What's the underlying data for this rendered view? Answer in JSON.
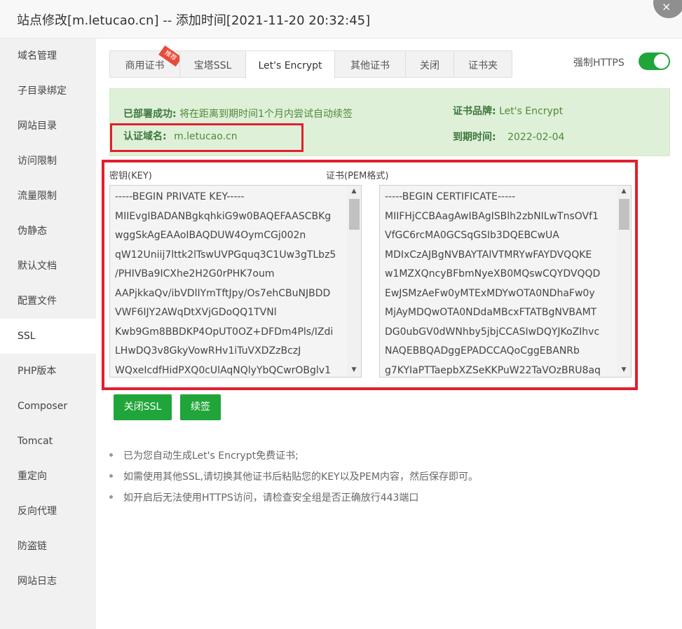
{
  "window": {
    "title": "站点修改[m.letucao.cn] -- 添加时间[2021-11-20 20:32:45]",
    "close_icon": "×"
  },
  "sidebar": {
    "items": [
      {
        "label": "域名管理"
      },
      {
        "label": "子目录绑定"
      },
      {
        "label": "网站目录"
      },
      {
        "label": "访问限制"
      },
      {
        "label": "流量限制"
      },
      {
        "label": "伪静态"
      },
      {
        "label": "默认文档"
      },
      {
        "label": "配置文件"
      },
      {
        "label": "SSL",
        "active": true
      },
      {
        "label": "PHP版本"
      },
      {
        "label": "Composer"
      },
      {
        "label": "Tomcat"
      },
      {
        "label": "重定向"
      },
      {
        "label": "反向代理"
      },
      {
        "label": "防盗链"
      },
      {
        "label": "网站日志"
      }
    ]
  },
  "tabs": [
    {
      "label": "商用证书",
      "badge": "推荐"
    },
    {
      "label": "宝塔SSL"
    },
    {
      "label": "Let's Encrypt",
      "active": true
    },
    {
      "label": "其他证书"
    },
    {
      "label": "关闭"
    },
    {
      "label": "证书夹"
    }
  ],
  "https_toggle": {
    "label": "强制HTTPS",
    "enabled": true
  },
  "status": {
    "deployed_label": "已部署成功:",
    "deployed_value": "将在距离到期时间1个月内尝试自动续签",
    "domain_label": "认证域名:",
    "domain_value": "m.letucao.cn",
    "brand_label": "证书品牌:",
    "brand_value": "Let's Encrypt",
    "expire_label": "到期时间:",
    "expire_value": "2022-02-04"
  },
  "key_field": {
    "label": "密钥(KEY)",
    "lines": [
      "-----BEGIN PRIVATE KEY-----",
      "MIIEvgIBADANBgkqhkiG9w0BAQEFAASCBKg",
      "wggSkAgEAAoIBAQDUW4OymCGj002n",
      "qW12Uniij7lttk2lTswUVPGquq3C1Uw3gTLbz5",
      "/PHIVBa9ICXhe2H2G0rPHK7oum",
      "AAPjkkaQv/ibVDlIYmTftJpy/Os7ehCBuNJBDD",
      "VWF6IJY2AWqDtXVjGDoQQ1TVNl",
      "Kwb9Gm8BBDKP4OpUT0OZ+DFDm4Pls/IZdi",
      "LHwDQ3v8GkyVowRHv1iTuVXDZzBczJ",
      "WQxeIcdfHidPXQ0cUlAqNQlyYbQCwrOBglv1"
    ]
  },
  "cert_field": {
    "label": "证书(PEM格式)",
    "lines": [
      "-----BEGIN CERTIFICATE-----",
      "MIIFHjCCBAagAwIBAgISBlh2zbNILwTnsOVf1",
      "VfGC6rcMA0GCSqGSIb3DQEBCwUA",
      "MDIxCzAJBgNVBAYTAlVTMRYwFAYDVQQKE",
      "w1MZXQncyBFbmNyeXB0MQswCQYDVQQD",
      "EwJSMzAeFw0yMTExMDYwOTA0NDhaFw0y",
      "MjAyMDQwOTA0NDdaMBcxFTATBgNVBAMT",
      "DG0ubGV0dWNhby5jbjCCASIwDQYJKoZIhvc",
      "NAQEBBQADggEPADCCAQoCggEBANRb",
      "g7KYIaPTTaepbXZSeKKPuW22TaVOzBRU8aq"
    ]
  },
  "buttons": {
    "close_ssl": "关闭SSL",
    "renew": "续签"
  },
  "tips": [
    "已为您自动生成Let's Encrypt免费证书;",
    "如需使用其他SSL,请切换其他证书后粘贴您的KEY以及PEM内容，然后保存即可。",
    "如开启后无法使用HTTPS访问，请检查安全组是否正确放行443端口"
  ],
  "colors": {
    "accent": "#20a53a",
    "highlight_frame": "#e0202e",
    "success_bg": "#dff0d8",
    "success_text": "#3c763d"
  }
}
